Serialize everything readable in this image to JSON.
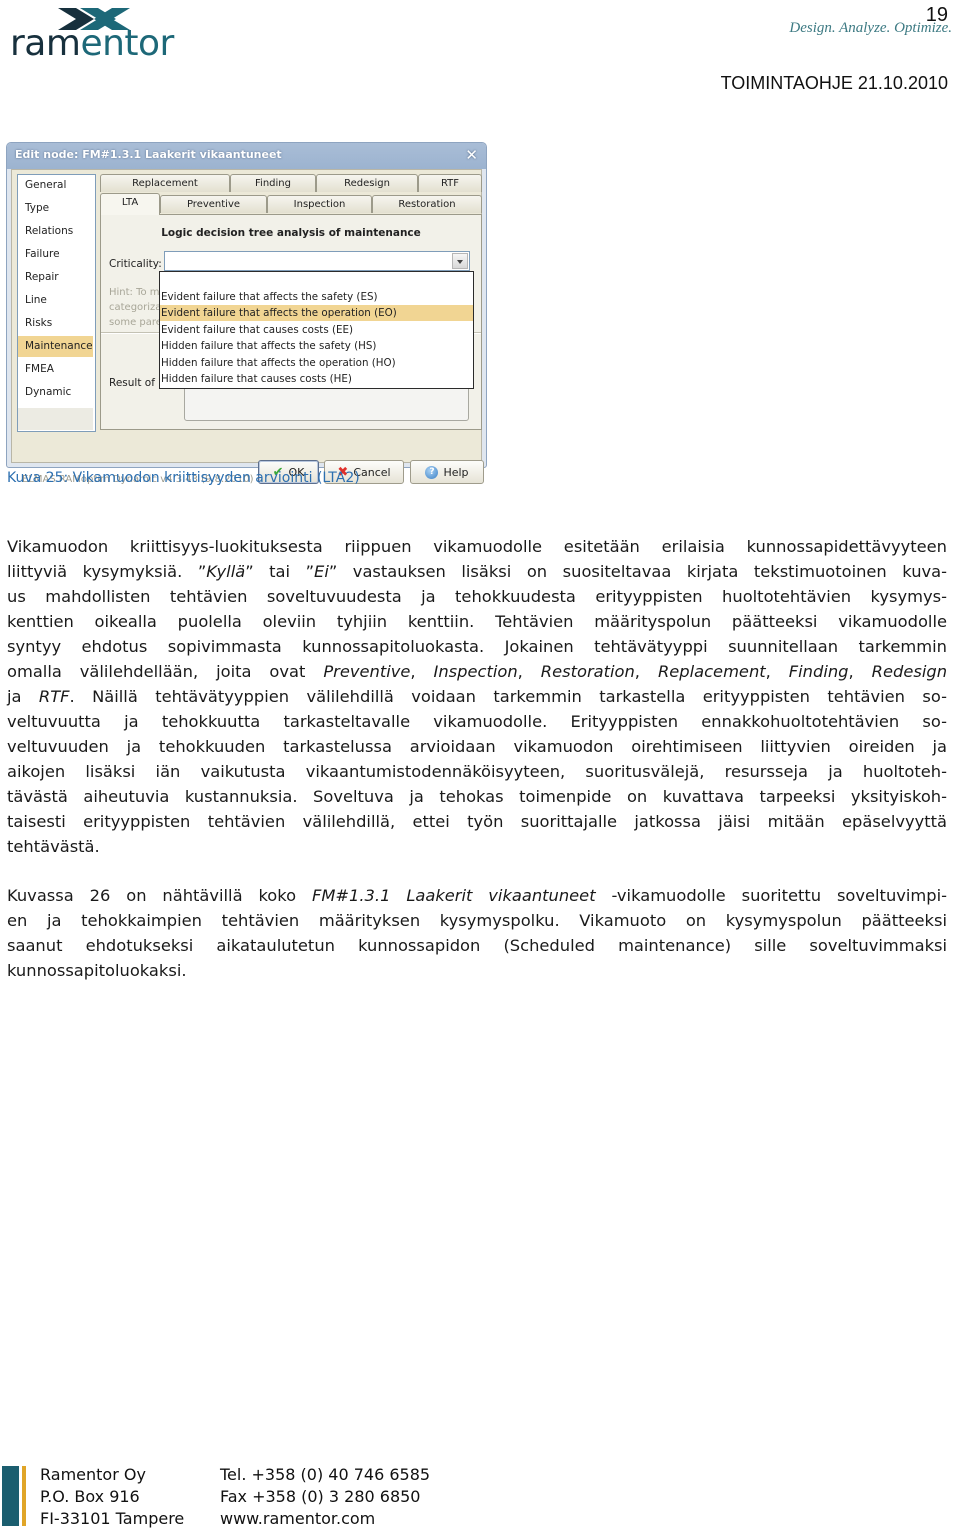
{
  "header": {
    "logo": {
      "part1": "ram",
      "part2": "entor",
      "mark_colors": [
        "#17303d",
        "#1d6878"
      ]
    },
    "page_number": "19",
    "tagline": "Design. Analyze. Optimize.",
    "doc_id": "TOIMINTAOHJE 21.10.2010"
  },
  "dialog": {
    "title": "Edit node: FM#1.3.1 Laakerit vikaantuneet",
    "close_icon": "close-icon",
    "nav": {
      "items": [
        {
          "label": "General"
        },
        {
          "label": "Type"
        },
        {
          "label": "Relations"
        },
        {
          "label": "Failure"
        },
        {
          "label": "Repair"
        },
        {
          "label": "Line"
        },
        {
          "label": "Risks"
        },
        {
          "label": "Maintenance",
          "selected": true
        },
        {
          "label": "FMEA"
        },
        {
          "label": "Dynamic"
        }
      ]
    },
    "tabs_row1": [
      {
        "label": "Replacement"
      },
      {
        "label": "Finding"
      },
      {
        "label": "Redesign"
      },
      {
        "label": "RTF"
      }
    ],
    "tabs_row2": [
      {
        "label": "LTA",
        "active": true
      },
      {
        "label": "Preventive"
      },
      {
        "label": "Inspection"
      },
      {
        "label": "Restoration"
      }
    ],
    "panel": {
      "title": "Logic decision tree analysis of maintenance",
      "criticality_label": "Criticality:",
      "criticality_value": "",
      "hint_lines": [
        "Hint: To ma",
        "categorizat",
        "some paren"
      ],
      "result_label": "Result of LT"
    },
    "dropdown": {
      "highlighted_index": 2,
      "highlight_color": "#f1d593",
      "options": [
        "",
        "Evident failure that affects the safety (ES)",
        "Evident failure that affects the operation (EO)",
        "Evident failure that causes costs (EE)",
        "Hidden failure that affects the safety (HS)",
        "Hidden failure that affects the operation (HO)",
        "Hidden failure that causes costs (HE)"
      ]
    },
    "version": "ELMAS RAMoptim Dynamic v4.3.43 (9.8.2010)",
    "buttons": {
      "ok": "OK",
      "cancel": "Cancel",
      "help": "Help"
    }
  },
  "caption": "Kuva 25: Vikamuodon kriittisyyden arviointi (LTA2)",
  "paragraph1": {
    "lines": [
      [
        "Vikamuodon kriittisyys-luokituksesta riippuen vikamuodolle esitetään erilaisia kunnossapidettävyyteen"
      ],
      [
        "liittyviä kysymyksiä. ”",
        {
          "i": "Kyllä"
        },
        "” tai ”",
        {
          "i": "Ei"
        },
        "” vastauksen lisäksi on suositeltavaa kirjata tekstimuotoinen kuva-"
      ],
      [
        "us mahdollisten tehtävien soveltuvuudesta ja tehokkuudesta erityyppisten huoltotehtävien kysymys-"
      ],
      [
        "kenttien oikealla puolella oleviin tyhjiin kenttiin. Tehtävien määrityspolun päätteeksi vikamuodolle"
      ],
      [
        "syntyy ehdotus sopivimmasta kunnossapitoluokasta. Jokainen tehtävätyyppi suunnitellaan tarkemmin"
      ],
      [
        "omalla välilehdellään, joita ovat ",
        {
          "i": "Preventive"
        },
        ", ",
        {
          "i": "Inspection"
        },
        ", ",
        {
          "i": "Restoration"
        },
        ", ",
        {
          "i": "Replacement"
        },
        ", ",
        {
          "i": "Finding"
        },
        ", ",
        {
          "i": "Redesign"
        }
      ],
      [
        "ja ",
        {
          "i": "RTF"
        },
        ". Näillä tehtävätyyppien välilehdillä voidaan tarkemmin tarkastella erityyppisten tehtävien so-"
      ],
      [
        "veltuvuutta ja tehokkuutta tarkasteltavalle vikamuodolle. Erityyppisten ennakkohuoltotehtävien so-"
      ],
      [
        "veltuvuuden ja tehokkuuden tarkastelussa arvioidaan vikamuodon oirehtimiseen liittyvien oireiden ja"
      ],
      [
        "aikojen lisäksi iän vaikutusta vikaantumistodennäköisyyteen, suoritusvälejä, resursseja ja huoltoteh-"
      ],
      [
        "tävästä aiheutuvia kustannuksia. Soveltuva ja tehokas toimenpide on kuvattava tarpeeksi yksityiskoh-"
      ],
      [
        "taisesti erityyppisten tehtävien välilehdillä, ettei työn suorittajalle jatkossa jäisi mitään epäselvyyttä"
      ],
      [
        "tehtävästä."
      ]
    ]
  },
  "paragraph2": {
    "lines": [
      [
        "Kuvassa 26 on nähtävillä koko ",
        {
          "i": "FM#1.3.1 Laakerit vikaantuneet"
        },
        " -vikamuodolle suoritettu soveltuvimpi-"
      ],
      [
        "en ja tehokkaimpien tehtävien määrityksen kysymyspolku. Vikamuoto on kysymyspolun päätteeksi"
      ],
      [
        "saanut ehdotukseksi aikataulutetun kunnossapidon (Scheduled maintenance) sille soveltuvimmaksi"
      ],
      [
        "kunnossapitoluokaksi."
      ]
    ]
  },
  "footer": {
    "accent_colors": [
      "#1b5e6f",
      "#e0a528"
    ],
    "col1": [
      "Ramentor Oy",
      "P.O. Box 916",
      "FI-33101 Tampere"
    ],
    "col2": [
      "Tel. +358 (0) 40 746 6585",
      "Fax +358 (0) 3 280 6850",
      "www.ramentor.com"
    ]
  }
}
